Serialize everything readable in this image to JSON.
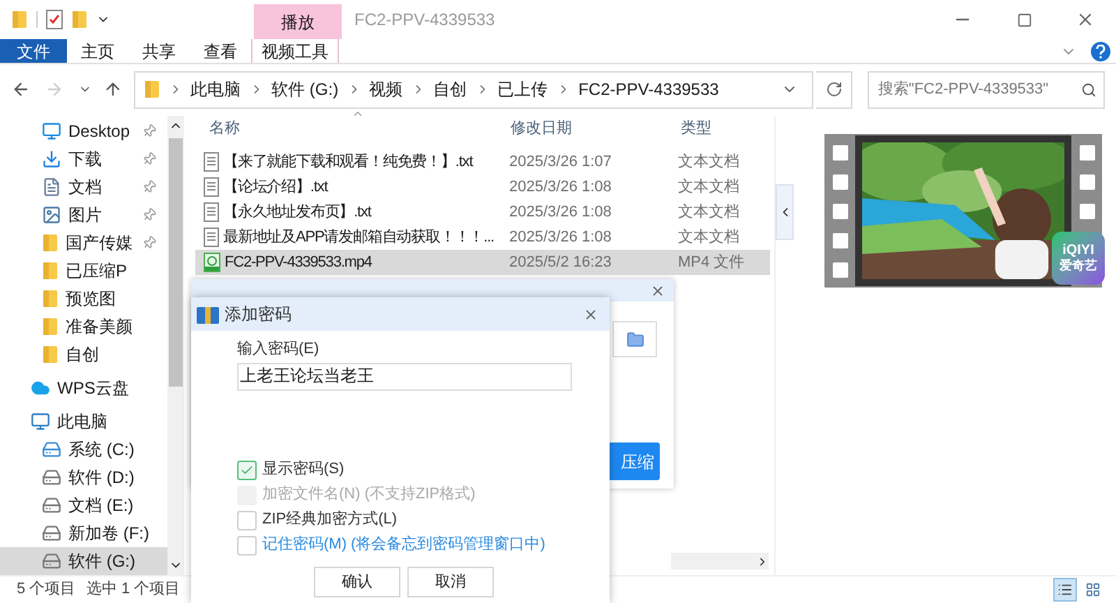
{
  "window": {
    "title": "FC2-PPV-4339533",
    "context_tab": "播放"
  },
  "ribbon": {
    "tabs": [
      {
        "label": "文件",
        "selected": true,
        "kind": "file"
      },
      {
        "label": "主页",
        "selected": false,
        "kind": "tab"
      },
      {
        "label": "共享",
        "selected": false,
        "kind": "tab"
      },
      {
        "label": "查看",
        "selected": false,
        "kind": "tab"
      },
      {
        "label": "视频工具",
        "selected": false,
        "kind": "context"
      }
    ]
  },
  "address": {
    "crumbs": [
      "此电脑",
      "软件 (G:)",
      "视频",
      "自创",
      "已上传",
      "FC2-PPV-4339533"
    ],
    "search_placeholder": "搜索\"FC2-PPV-4339533\""
  },
  "sidebar": {
    "quick_access": [
      {
        "label": "Desktop",
        "kind": "desktop",
        "pinned": true
      },
      {
        "label": "下载",
        "kind": "download",
        "pinned": true
      },
      {
        "label": "文档",
        "kind": "document",
        "pinned": true
      },
      {
        "label": "图片",
        "kind": "pictures",
        "pinned": true
      },
      {
        "label": "国产传媒",
        "kind": "folder",
        "pinned": true
      },
      {
        "label": "已压缩P",
        "kind": "folder",
        "pinned": false
      },
      {
        "label": "预览图",
        "kind": "folder",
        "pinned": false
      },
      {
        "label": "准备美颜",
        "kind": "folder",
        "pinned": false
      },
      {
        "label": "自创",
        "kind": "folder",
        "pinned": false
      }
    ],
    "items": [
      {
        "label": "WPS云盘",
        "kind": "cloud",
        "selected": false
      },
      {
        "label": "此电脑",
        "kind": "pc",
        "selected": false,
        "children": [
          {
            "label": "系统 (C:)",
            "kind": "windrive",
            "selected": false
          },
          {
            "label": "软件 (D:)",
            "kind": "drive",
            "selected": false
          },
          {
            "label": "文档 (E:)",
            "kind": "drive",
            "selected": false
          },
          {
            "label": "新加卷 (F:)",
            "kind": "drive",
            "selected": false
          },
          {
            "label": "软件 (G:)",
            "kind": "drive",
            "selected": true
          }
        ]
      }
    ]
  },
  "table": {
    "columns": [
      "名称",
      "修改日期",
      "类型"
    ],
    "rows": [
      {
        "name": "【来了就能下载和观看！纯免费！】.txt",
        "date": "2025/3/26 1:07",
        "type": "文本文档",
        "kind": "text",
        "selected": false
      },
      {
        "name": "【论坛介绍】.txt",
        "date": "2025/3/26 1:08",
        "type": "文本文档",
        "kind": "text",
        "selected": false
      },
      {
        "name": "【永久地址发布页】.txt",
        "date": "2025/3/26 1:08",
        "type": "文本文档",
        "kind": "text",
        "selected": false
      },
      {
        "name": "最新地址及APP请发邮箱自动获取！！！...",
        "date": "2025/3/26 1:08",
        "type": "文本文档",
        "kind": "text",
        "selected": false
      },
      {
        "name": "FC2-PPV-4339533.mp4",
        "date": "2025/5/2 16:23",
        "type": "MP4 文件",
        "kind": "video",
        "selected": true
      }
    ]
  },
  "preview": {
    "badge": [
      "iQIYI",
      "爱奇艺"
    ]
  },
  "status_bar": {
    "count": "5 个项目",
    "selection": "选中 1 个项目"
  },
  "back_dialog": {
    "button": "压缩"
  },
  "dialog": {
    "title": "添加密码",
    "field_label": "输入密码(E)",
    "password": "上老王论坛当老王",
    "options": [
      {
        "label": "显示密码(S)",
        "checked": true,
        "disabled": false,
        "kind": "plain"
      },
      {
        "label": "加密文件名(N) (不支持ZIP格式)",
        "checked": false,
        "disabled": true,
        "kind": "plain"
      },
      {
        "label": "ZIP经典加密方式(L)",
        "checked": false,
        "disabled": false,
        "kind": "plain"
      },
      {
        "label": "记住密码(M) (将会备忘到密码管理窗口中)",
        "checked": false,
        "disabled": false,
        "kind": "link"
      }
    ],
    "buttons": [
      "确认",
      "取消"
    ]
  }
}
